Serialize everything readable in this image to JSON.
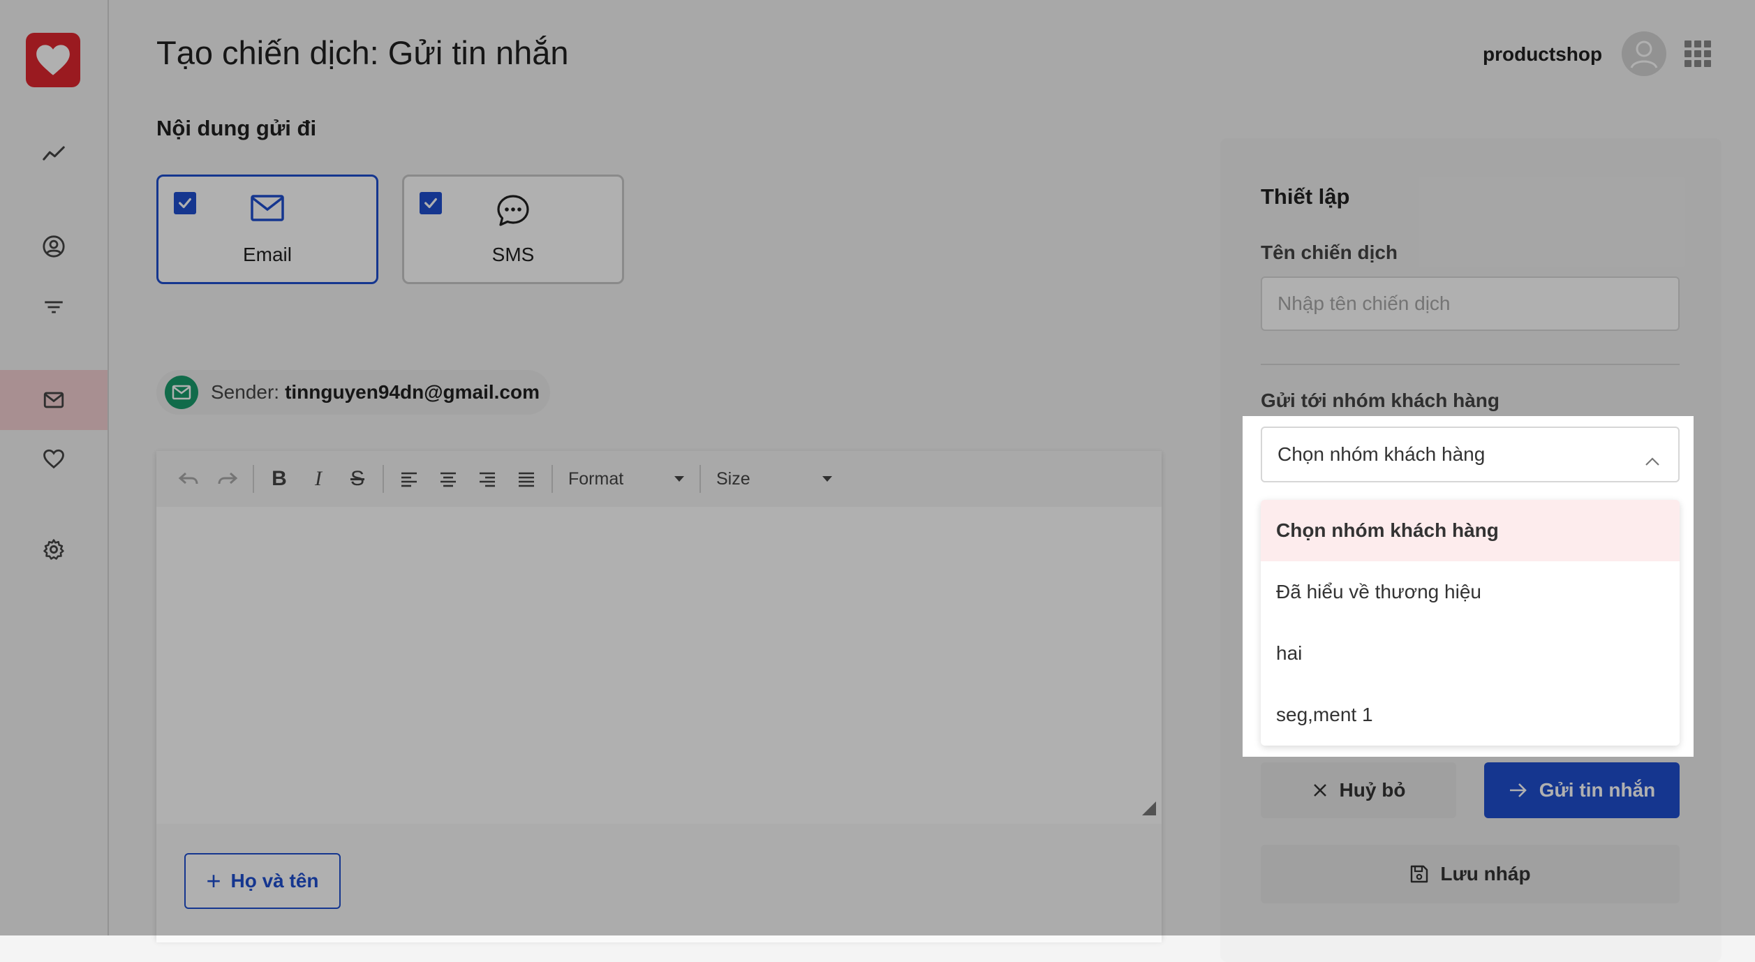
{
  "header": {
    "title": "Tạo chiến dịch: Gửi tin nhắn",
    "user_name": "productshop"
  },
  "sidebar": {
    "items": [
      {
        "name": "analytics",
        "icon": "trend-icon"
      },
      {
        "name": "customers",
        "icon": "user-circle-icon"
      },
      {
        "name": "segments",
        "icon": "filter-icon"
      },
      {
        "name": "campaigns",
        "icon": "mail-icon",
        "active": true
      },
      {
        "name": "loyalty",
        "icon": "heart-icon"
      },
      {
        "name": "settings",
        "icon": "gear-icon"
      }
    ]
  },
  "content": {
    "section_title": "Nội dung gửi đi",
    "channels": [
      {
        "label": "Email",
        "checked": true,
        "selected": true
      },
      {
        "label": "SMS",
        "checked": true,
        "selected": false
      }
    ],
    "sender": {
      "label": "Sender:",
      "email": "tinnguyen94dn@gmail.com"
    },
    "editor": {
      "format_label": "Format",
      "size_label": "Size"
    },
    "variable_button": "Họ và tên"
  },
  "settings": {
    "title": "Thiết lập",
    "campaign_name_label": "Tên chiến dịch",
    "campaign_name_placeholder": "Nhập tên chiến dịch",
    "campaign_name_value": "",
    "group_label": "Gửi tới nhóm khách hàng",
    "group_selected": "Chọn nhóm khách hàng",
    "group_options": [
      "Chọn nhóm khách hàng",
      "Đã hiểu về thương hiệu",
      "hai",
      "seg,ment 1"
    ],
    "cancel_label": "Huỷ bỏ",
    "send_label": "Gửi tin nhắn",
    "draft_label": "Lưu nháp"
  },
  "colors": {
    "brand": "#e0262f",
    "primary": "#1f4fd0",
    "sender_green": "#1a9b6c",
    "selected_option_bg": "#fdeced",
    "active_nav_bg": "#f3d0d2"
  }
}
